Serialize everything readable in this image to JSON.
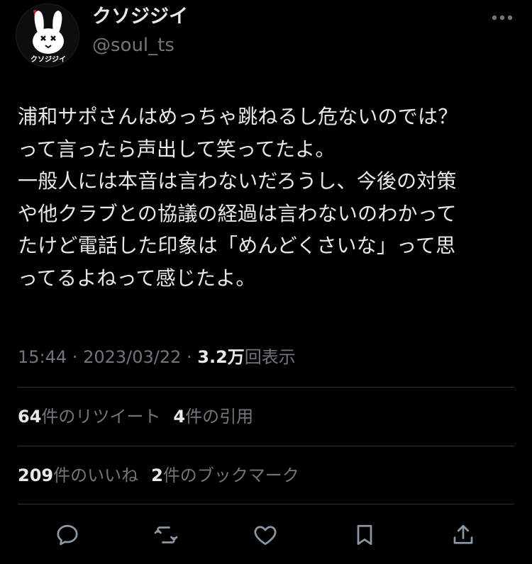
{
  "author": {
    "display_name": "クソジジイ",
    "handle": "@soul_ts",
    "avatar_label": "クソジジイ"
  },
  "tweet": {
    "text": "浦和サポさんはめっちゃ跳ねるし危ないのでは？\nって言ったら声出して笑ってたよ。\n一般人には本音は言わないだろうし、今後の対策\nや他クラブとの協議の経過は言わないのわかって\nたけど電話した印象は「めんどくさいな」って思\nってるよねって感じたよ。"
  },
  "meta": {
    "time": "15:44",
    "sep1": " · ",
    "date": "2023/03/22",
    "sep2": " · ",
    "views_count": "3.2万",
    "views_label": "回表示"
  },
  "stats": {
    "retweets_count": "64",
    "retweets_label": "件のリツイート",
    "quotes_count": "4",
    "quotes_label": "件の引用",
    "likes_count": "209",
    "likes_label": "件のいいね",
    "bookmarks_count": "2",
    "bookmarks_label": "件のブックマーク"
  },
  "icons": {
    "more": "more-dots-icon",
    "reply": "reply-icon",
    "retweet": "retweet-icon",
    "like": "heart-icon",
    "bookmark": "bookmark-icon",
    "share": "share-icon"
  },
  "colors": {
    "background": "#000000",
    "text_primary": "#e7e9ea",
    "text_secondary": "#71767b",
    "divider": "#2f3336",
    "avatar_accent": "#d11f2a"
  }
}
